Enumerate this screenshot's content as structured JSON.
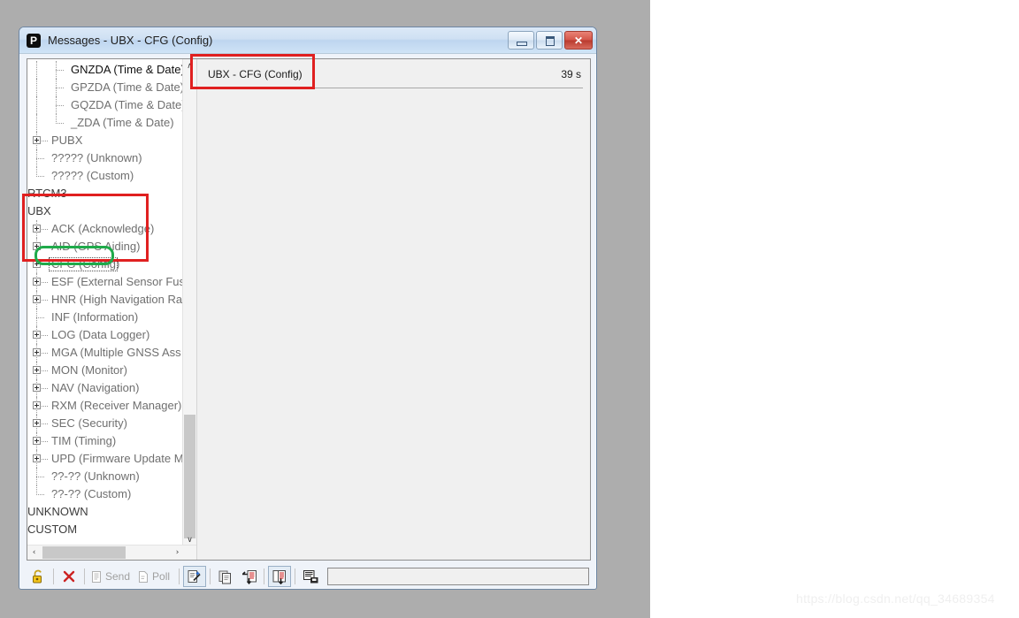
{
  "window": {
    "title": "Messages - UBX - CFG (Config)",
    "app_icon": "ublox-p-icon",
    "buttons": {
      "minimize": "minimize",
      "maximize": "maximize",
      "close": "✕"
    }
  },
  "tree": {
    "items": [
      {
        "label": "GNZDA (Time & Date)",
        "indent": 3,
        "kind": "leaf",
        "tone": "black"
      },
      {
        "label": "GPZDA (Time & Date)",
        "indent": 3,
        "kind": "leaf",
        "tone": "gray"
      },
      {
        "label": "GQZDA (Time & Date)",
        "indent": 3,
        "kind": "leaf",
        "tone": "gray"
      },
      {
        "label": "_ZDA (Time & Date)",
        "indent": 3,
        "kind": "last-leaf",
        "tone": "gray"
      },
      {
        "label": "PUBX",
        "indent": 1,
        "kind": "expandable",
        "tone": "gray"
      },
      {
        "label": "????? (Unknown)",
        "indent": 1,
        "kind": "leaf",
        "tone": "gray"
      },
      {
        "label": "????? (Custom)",
        "indent": 1,
        "kind": "last-leaf",
        "tone": "gray"
      },
      {
        "label": "RTCM3",
        "indent": 0,
        "kind": "root",
        "tone": "dark"
      },
      {
        "label": "UBX",
        "indent": 0,
        "kind": "root",
        "tone": "dark"
      },
      {
        "label": "ACK (Acknowledge)",
        "indent": 1,
        "kind": "expandable",
        "tone": "gray"
      },
      {
        "label": "AID (GPS Aiding)",
        "indent": 1,
        "kind": "expandable",
        "tone": "gray"
      },
      {
        "label": "CFG (Config)",
        "indent": 1,
        "kind": "expandable",
        "tone": "gray",
        "focused": true
      },
      {
        "label": "ESF (External Sensor Fusi",
        "indent": 1,
        "kind": "expandable",
        "tone": "gray"
      },
      {
        "label": "HNR (High Navigation Ra",
        "indent": 1,
        "kind": "expandable",
        "tone": "gray"
      },
      {
        "label": "INF (Information)",
        "indent": 1,
        "kind": "leaf",
        "tone": "gray"
      },
      {
        "label": "LOG (Data Logger)",
        "indent": 1,
        "kind": "expandable",
        "tone": "gray"
      },
      {
        "label": "MGA (Multiple GNSS Ass",
        "indent": 1,
        "kind": "expandable",
        "tone": "gray"
      },
      {
        "label": "MON (Monitor)",
        "indent": 1,
        "kind": "expandable",
        "tone": "gray"
      },
      {
        "label": "NAV (Navigation)",
        "indent": 1,
        "kind": "expandable",
        "tone": "gray"
      },
      {
        "label": "RXM (Receiver Manager)",
        "indent": 1,
        "kind": "expandable",
        "tone": "gray"
      },
      {
        "label": "SEC (Security)",
        "indent": 1,
        "kind": "expandable",
        "tone": "gray"
      },
      {
        "label": "TIM (Timing)",
        "indent": 1,
        "kind": "expandable",
        "tone": "gray"
      },
      {
        "label": "UPD (Firmware Update M",
        "indent": 1,
        "kind": "expandable",
        "tone": "gray"
      },
      {
        "label": "??-?? (Unknown)",
        "indent": 1,
        "kind": "leaf",
        "tone": "gray"
      },
      {
        "label": "??-?? (Custom)",
        "indent": 1,
        "kind": "last-leaf",
        "tone": "gray"
      },
      {
        "label": "UNKNOWN",
        "indent": 0,
        "kind": "root",
        "tone": "dark"
      },
      {
        "label": "CUSTOM",
        "indent": 0,
        "kind": "root",
        "tone": "dark"
      }
    ],
    "scroll": {
      "up_arrow": "∧",
      "down_arrow": "∨",
      "left_arrow": "‹",
      "right_arrow": "›"
    }
  },
  "message_panel": {
    "title": "UBX - CFG (Config)",
    "age": "39 s"
  },
  "toolbar": {
    "lock": "lock-icon",
    "clear": "✕",
    "send_label": "Send",
    "poll_label": "Poll",
    "input_value": ""
  },
  "annotations": {
    "red_boxes": 2,
    "green_boxes": 1,
    "red_color": "#e02020",
    "green_color": "#1faa4a"
  },
  "watermark": "https://blog.csdn.net/qq_34689354"
}
